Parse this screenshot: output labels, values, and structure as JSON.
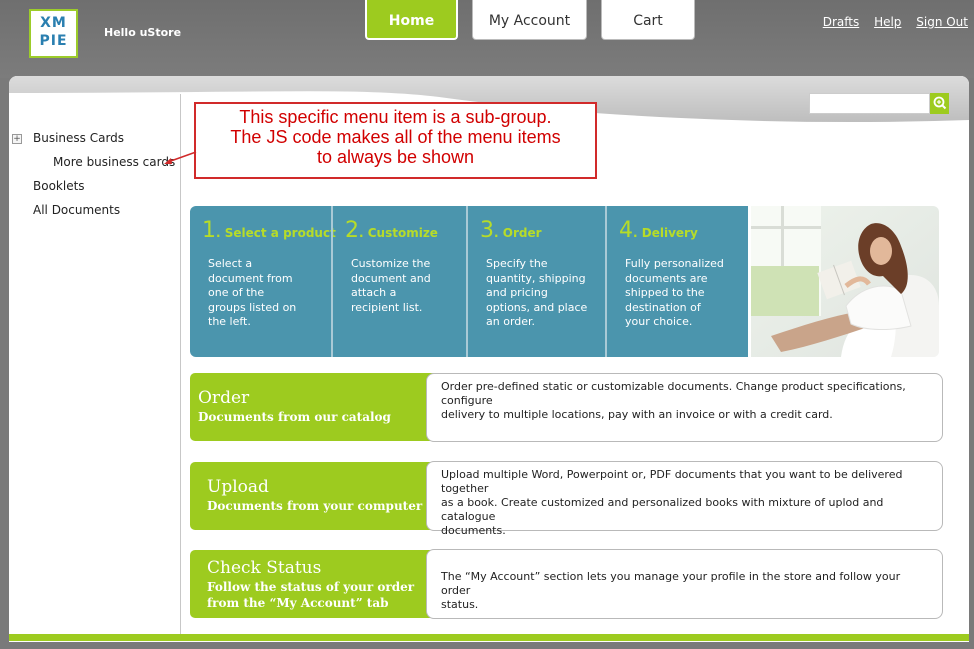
{
  "header": {
    "logo_line1": "XM",
    "logo_line2": "PIE",
    "greeting": "Hello uStore",
    "tabs": [
      {
        "label": "Home",
        "active": true
      },
      {
        "label": "My Account",
        "active": false
      },
      {
        "label": "Cart",
        "active": false
      }
    ],
    "links": [
      "Drafts",
      "Help",
      "Sign Out"
    ]
  },
  "search": {
    "value": ""
  },
  "sidebar": {
    "expander_symbol": "+",
    "items": [
      {
        "label": "Business Cards"
      },
      {
        "label": "More business cards"
      },
      {
        "label": "Booklets"
      },
      {
        "label": "All Documents"
      }
    ]
  },
  "annotation": {
    "lines": [
      "This specific menu item is a sub-group.",
      "The JS code makes all of the menu items",
      "to always be shown"
    ]
  },
  "steps": [
    {
      "number": "1",
      "title": ". Select a product",
      "lines": [
        "Select a",
        "document from",
        "one of the",
        "groups listed on",
        "the left."
      ]
    },
    {
      "number": "2",
      "title": ". Customize",
      "lines": [
        "Customize the",
        "document and",
        "attach a",
        "recipient list."
      ]
    },
    {
      "number": "3",
      "title": ". Order",
      "lines": [
        "Specify the",
        "quantity, shipping",
        "and pricing",
        "options, and place",
        "an order."
      ]
    },
    {
      "number": "4",
      "title": ". Delivery",
      "lines": [
        "Fully personalized",
        "documents are",
        "shipped to the",
        "destination of",
        "your choice."
      ]
    }
  ],
  "blocks": [
    {
      "title": "Order",
      "subtitle_lines": [
        "Documents from our catalog"
      ],
      "desc_lines": [
        "Order pre-defined static or customizable documents. Change product specifications, configure",
        "delivery to multiple locations, pay with an invoice or with a credit card."
      ]
    },
    {
      "title": "Upload",
      "subtitle_lines": [
        "Documents from your computer"
      ],
      "desc_lines": [
        "Upload multiple Word, Powerpoint or, PDF documents that you want to be delivered together",
        "as a book. Create customized and personalized books with mixture of uplod and catalogue",
        "documents."
      ]
    },
    {
      "title": "Check Status",
      "subtitle_lines": [
        "Follow the status of your order",
        "from the “My Account” tab"
      ],
      "desc_lines": [
        "The “My Account” section lets you manage your profile in the store and follow your order",
        "status."
      ]
    }
  ],
  "colors": {
    "accent_green": "#9dcb1f",
    "step_blue": "#4b95ad",
    "annotation_red": "#d10000"
  }
}
